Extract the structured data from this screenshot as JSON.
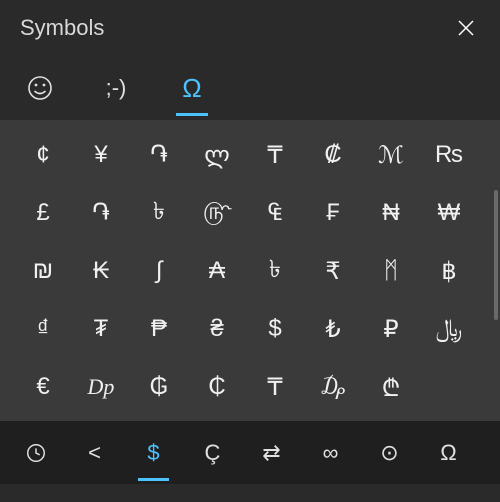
{
  "header": {
    "title": "Symbols"
  },
  "tabs": {
    "emoji_label": "☺",
    "kaomoji_label": ";-)",
    "symbols_label": "Ω"
  },
  "grid": {
    "rows": [
      [
        "¢",
        "¥",
        "֏",
        "ლ",
        "₸",
        "₡",
        "ℳ",
        "₨"
      ],
      [
        "£",
        "֏",
        "৳",
        "௹",
        "₠",
        "₣",
        "₦",
        "₩"
      ],
      [
        "₪",
        "₭",
        "∫",
        "₳",
        "৳",
        "₹",
        "ᛗ",
        "฿"
      ],
      [
        "₫",
        "₮",
        "₱",
        "₴",
        "$",
        "₺",
        "₽",
        "﷼"
      ],
      [
        "€",
        "Dp",
        "₲",
        "₵",
        "₸",
        "₯",
        "₾",
        ""
      ]
    ]
  },
  "bottom": {
    "items": [
      "",
      "<",
      "$",
      "Ç",
      "⇄",
      "∞",
      "⊙",
      "Ω"
    ]
  }
}
